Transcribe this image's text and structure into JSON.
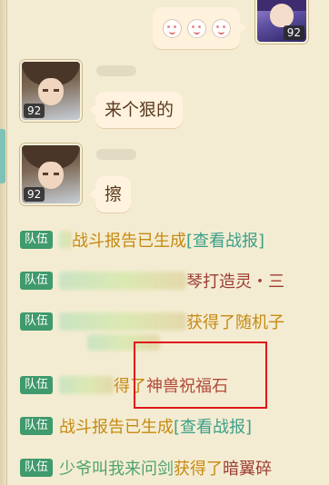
{
  "own_message": {
    "level": "92",
    "content_icons": [
      "smile-face-icon",
      "smile-face-icon",
      "smile-face-icon"
    ]
  },
  "messages": [
    {
      "level": "92",
      "text": "来个狠的"
    },
    {
      "level": "92",
      "text": "擦"
    }
  ],
  "team_tag": "队伍",
  "team_lines": [
    {
      "text_a": "战斗报告已生成",
      "link": "[查看战报]"
    },
    {
      "text_a": "琴打造灵・三"
    },
    {
      "text_a": "获得了随机子"
    },
    {
      "text_a": "得了",
      "text_b": "神兽祝福石"
    },
    {
      "text_a": "战斗报告已生成",
      "link": "[查看战报]"
    },
    {
      "name": "少爷叫我来问剑",
      "text_a": "获得了",
      "text_b": "暗翼碎"
    }
  ],
  "colors": {
    "background": "#f4ecd2",
    "team_tag": "#3f9a6c",
    "gold_text": "#c58a12",
    "teal_text": "#3aa089",
    "red_text": "#b24a3a",
    "highlight": "#e0161b"
  }
}
